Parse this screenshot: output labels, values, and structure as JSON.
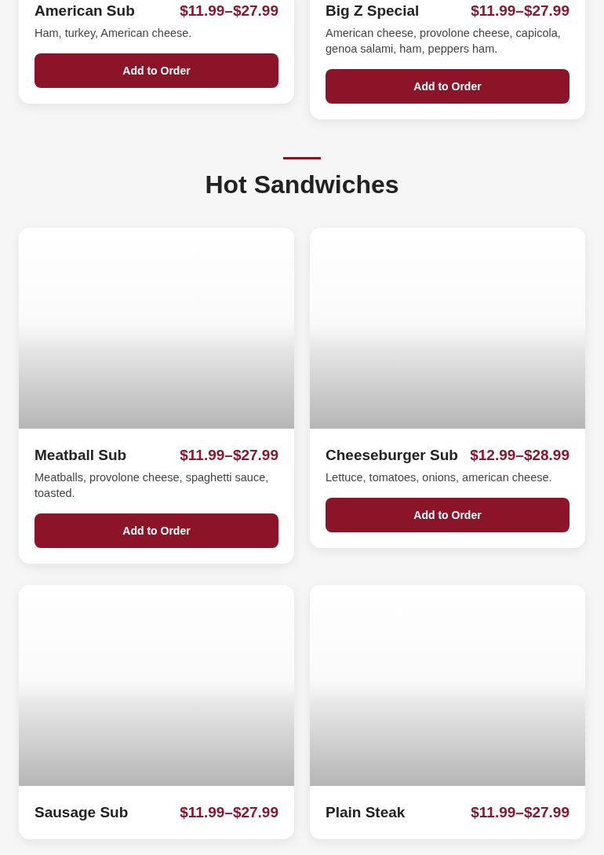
{
  "sections": [
    {
      "items": [
        {
          "name": "American Sub",
          "price": "$11.99–$27.99",
          "description": "Ham, turkey, American cheese.",
          "button": "Add to Order"
        },
        {
          "name": "Big Z Special",
          "price": "$11.99–$27.99",
          "description": "American cheese, provolone cheese, capicola, genoa salami, ham, peppers ham.",
          "button": "Add to Order"
        }
      ]
    },
    {
      "title": "Hot Sandwiches",
      "items": [
        {
          "name": "Meatball Sub",
          "price": "$11.99–$27.99",
          "description": "Meatballs, provolone cheese, spaghetti sauce, toasted.",
          "button": "Add to Order"
        },
        {
          "name": "Cheeseburger Sub",
          "price": "$12.99–$28.99",
          "description": "Lettuce, tomatoes, onions, american cheese.",
          "button": "Add to Order"
        },
        {
          "name": "Sausage Sub",
          "price": "$11.99–$27.99"
        },
        {
          "name": "Plain Steak",
          "price": "$11.99–$27.99"
        }
      ]
    }
  ]
}
